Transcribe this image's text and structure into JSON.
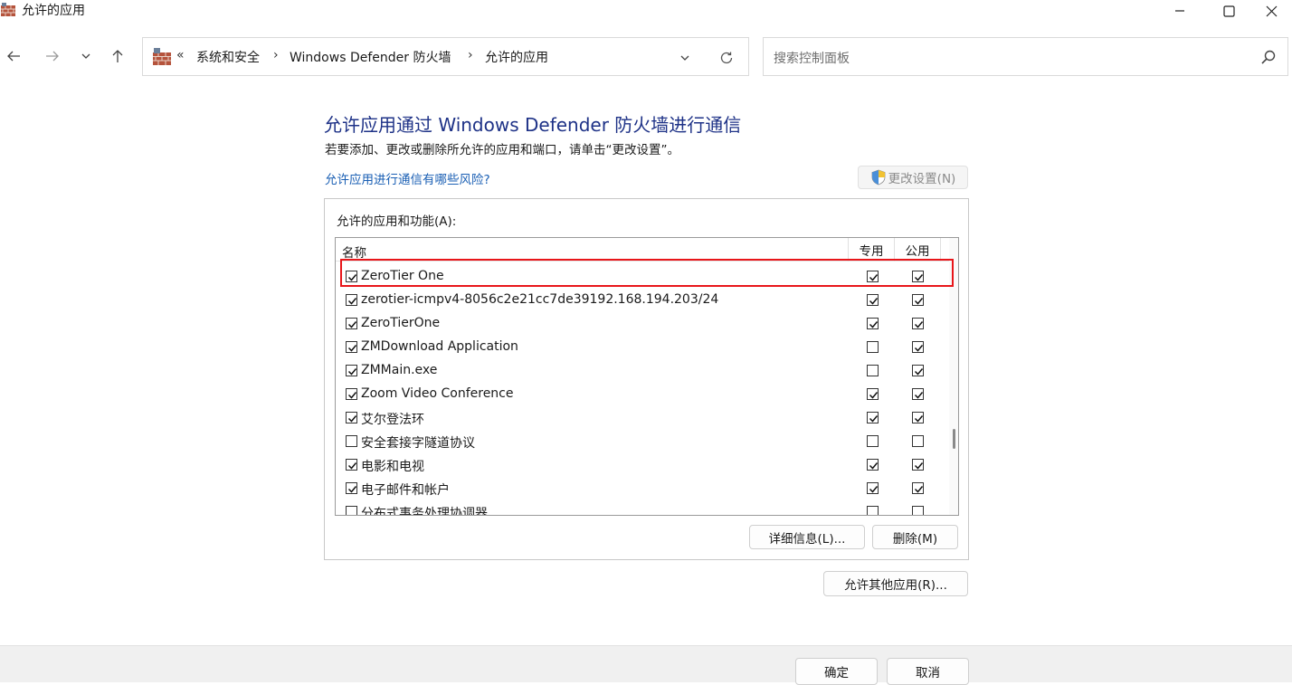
{
  "window": {
    "title": "允许的应用",
    "controls": [
      "minimize-icon",
      "maximize-icon",
      "close-icon"
    ]
  },
  "nav": {
    "back_icon": "arrow-left-icon",
    "forward_icon": "arrow-right-icon",
    "recent_icon": "chevron-down-icon",
    "up_icon": "arrow-up-icon"
  },
  "address": {
    "overflow": "«",
    "crumbs": [
      "系统和安全",
      "Windows Defender 防火墙",
      "允许的应用"
    ],
    "separator": "›"
  },
  "search": {
    "placeholder": "搜索控制面板"
  },
  "main": {
    "heading": "允许应用通过 Windows Defender 防火墙进行通信",
    "subtext": "若要添加、更改或删除所允许的应用和端口，请单击“更改设置”。",
    "risk_link": "允许应用进行通信有哪些风险?",
    "change_settings_label": "更改设置(N)",
    "group_label": "允许的应用和功能(A):",
    "columns": {
      "name": "名称",
      "private": "专用",
      "public": "公用"
    },
    "rows": [
      {
        "name": "ZeroTier One",
        "enabled": true,
        "private": true,
        "public": true
      },
      {
        "name": "zerotier-icmpv4-8056c2e21cc7de39192.168.194.203/24",
        "enabled": true,
        "private": true,
        "public": true
      },
      {
        "name": "ZeroTierOne",
        "enabled": true,
        "private": true,
        "public": true
      },
      {
        "name": "ZMDownload Application",
        "enabled": true,
        "private": false,
        "public": true
      },
      {
        "name": "ZMMain.exe",
        "enabled": true,
        "private": false,
        "public": true
      },
      {
        "name": "Zoom Video Conference",
        "enabled": true,
        "private": true,
        "public": true
      },
      {
        "name": "艾尔登法环",
        "enabled": true,
        "private": true,
        "public": true
      },
      {
        "name": "安全套接字隧道协议",
        "enabled": false,
        "private": false,
        "public": false
      },
      {
        "name": "电影和电视",
        "enabled": true,
        "private": true,
        "public": true
      },
      {
        "name": "电子邮件和帐户",
        "enabled": true,
        "private": true,
        "public": true
      },
      {
        "name": "分布式事务处理协调器",
        "enabled": false,
        "private": false,
        "public": false
      }
    ],
    "details_label": "详细信息(L)...",
    "delete_label": "删除(M)",
    "allow_other_label": "允许其他应用(R)..."
  },
  "footer": {
    "ok_label": "确定",
    "cancel_label": "取消"
  },
  "colors": {
    "heading": "#1e3287",
    "link": "#1a5fb4",
    "highlight": "#e8161a"
  }
}
